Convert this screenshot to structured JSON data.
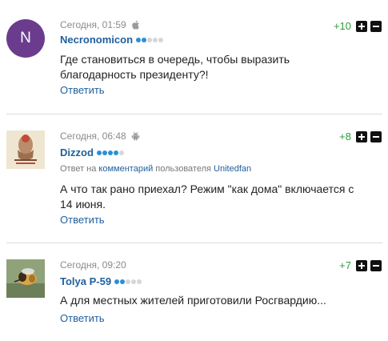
{
  "comments": [
    {
      "avatar_letter": "N",
      "avatar_color": "#6b3c8e",
      "time": "Сегодня, 01:59",
      "device": "apple-icon",
      "author": "Necronomicon",
      "rating_dots": 5,
      "rating_filled": 2,
      "score": "+10",
      "text": "Где становиться в очередь, чтобы выразить благодарность президенту?!",
      "reply_label": "Ответить"
    },
    {
      "avatar_type": "image",
      "time": "Сегодня, 06:48",
      "device": "android-icon",
      "author": "Dizzod",
      "rating_dots": 5,
      "rating_filled": 4,
      "reply_to": {
        "prefix": "Ответ на",
        "link": "комментарий",
        "middle": "пользователя",
        "user": "Unitedfan"
      },
      "score": "+8",
      "text": "А что так рано приехал? Режим \"как дома\" включается с 14 июня.",
      "reply_label": "Ответить"
    },
    {
      "avatar_type": "image",
      "time": "Сегодня, 09:20",
      "author": "Tolya P-59",
      "rating_dots": 5,
      "rating_filled": 2,
      "score": "+7",
      "text": "А для местных жителей приготовили Росгвардию...",
      "reply_label": "Ответить"
    }
  ],
  "colors": {
    "author": "#1f5f9c",
    "score": "#2e9c3f",
    "dot_filled": "#2a8fd6",
    "dot_empty": "#d6d6d6"
  }
}
